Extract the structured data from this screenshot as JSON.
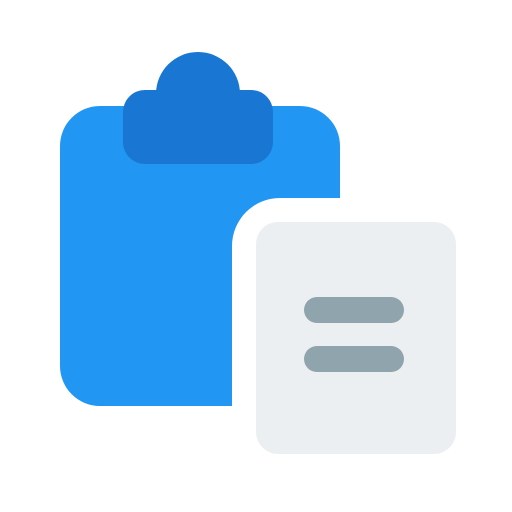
{
  "icon": {
    "name": "clipboard-paste-icon",
    "colors": {
      "clipboard_board": "#2196F3",
      "clipboard_clip": "#1976D2",
      "document_sheet": "#ECEFF1",
      "document_lines": "#90A4AE",
      "background": "#FFFFFF"
    }
  }
}
